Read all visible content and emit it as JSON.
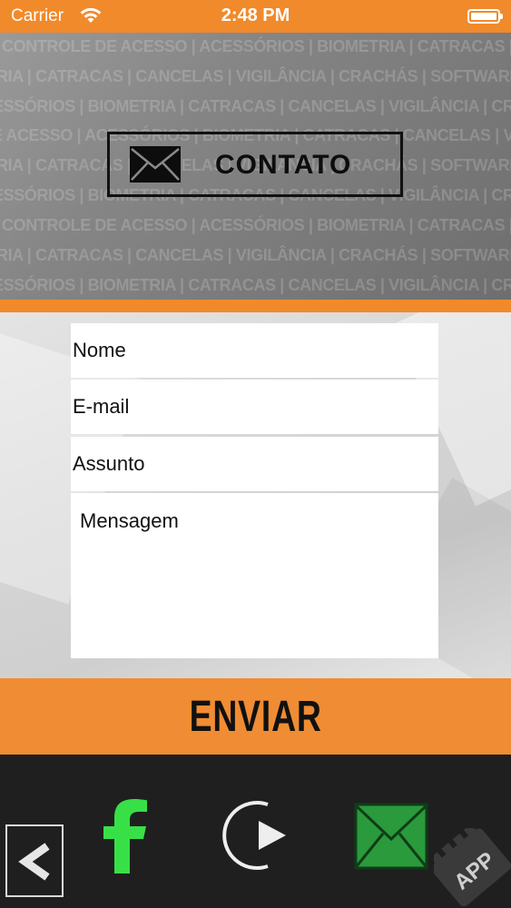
{
  "status_bar": {
    "carrier": "Carrier",
    "time": "2:48 PM"
  },
  "header": {
    "title": "CONTATO",
    "pattern_rows": [
      "CONTROLE DE ACESSO | ACESSÓRIOS | BIOMETRIA | CATRACAS | CANCELAS | VIGILÂNCIA | CRACHÁS | SOFTWARES",
      "RIA | CATRACAS | CANCELAS | VIGILÂNCIA | CRACHÁS | SOFTWARES | CONTROLE DE ACESSO | ACESSÓRIOS",
      "ESSÓRIOS | BIOMETRIA | CATRACAS | CANCELAS | VIGILÂNCIA | CRACHÁS | SOFTWARES | CONTROLE DE ACESSO",
      "E DE ACESSO | ACESSÓRIOS | BIOMETRIA | CATRACAS | CANCELAS | VIGILÂNCIA | CRACHÁS | SOFTWARES",
      "RIA | CATRACAS | CANCELAS | VIGILÂNCIA | CRACHÁS | SOFTWARES | CONTROLE DE ACESSO | ACESSÓRIOS",
      "ESSÓRIOS | BIOMETRIA | CATRACAS | CANCELAS | VIGILÂNCIA | CRACHÁS | SOFTWARES | CONTROLE DE ACESSO",
      "CONTROLE DE ACESSO | ACESSÓRIOS | BIOMETRIA | CATRACAS | CANCELAS | VIGILÂNCIA | CRACHÁS | SOFTWARES",
      "RIA | CATRACAS | CANCELAS | VIGILÂNCIA | CRACHÁS | SOFTWARES | CONTROLE DE ACESSO | ACESSÓRIOS",
      "ESSÓRIOS | BIOMETRIA | CATRACAS | CANCELAS | VIGILÂNCIA | CRACHÁS | SOFTWARES | CONTROLE DE ACESSO"
    ]
  },
  "form": {
    "name_placeholder": "Nome",
    "email_placeholder": "E-mail",
    "subject_placeholder": "Assunto",
    "message_placeholder": "Mensagem",
    "send_label": "ENVIAR"
  },
  "bottom_bar": {
    "logo_text": "APP"
  },
  "colors": {
    "accent": "#f18a2b",
    "bottom_bar": "#1f1f1f",
    "facebook_icon": "#38e047",
    "mail_icon_fill": "#2a9a3c"
  },
  "icons": [
    "wifi-icon",
    "battery-icon",
    "envelope-icon",
    "back-arrow-icon",
    "facebook-icon",
    "play-icon",
    "mail-icon",
    "app-logo"
  ]
}
